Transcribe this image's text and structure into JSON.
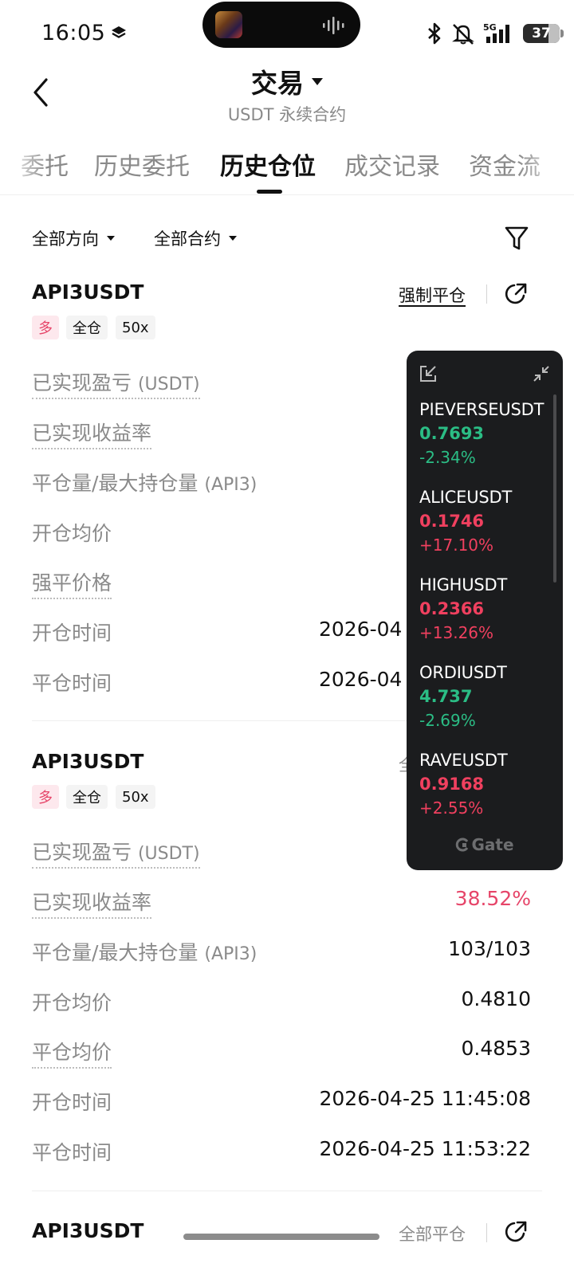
{
  "status_bar": {
    "time": "16:05",
    "network": "5G",
    "battery": "37"
  },
  "header": {
    "title": "交易",
    "subtitle": "USDT 永续合约"
  },
  "tabs": [
    {
      "label": "委托"
    },
    {
      "label": "历史委托"
    },
    {
      "label": "历史仓位"
    },
    {
      "label": "成交记录"
    },
    {
      "label": "资金流"
    }
  ],
  "filters": {
    "direction": "全部方向",
    "contract": "全部合约"
  },
  "positions": [
    {
      "symbol": "API3USDT",
      "action": "强制平仓",
      "tags": {
        "side": "多",
        "margin": "全仓",
        "leverage": "50x"
      },
      "rows": [
        {
          "label": "已实现盈亏",
          "unit": "(USDT)",
          "value": ""
        },
        {
          "label": "已实现收益率",
          "value": ""
        },
        {
          "label": "平仓量/最大持仓量",
          "unit": "(API3)",
          "value": ""
        },
        {
          "label": "开仓均价",
          "value": ""
        },
        {
          "label": "强平价格",
          "value": ""
        },
        {
          "label": "开仓时间",
          "value": "2026-04"
        },
        {
          "label": "平仓时间",
          "value": "2026-04"
        }
      ]
    },
    {
      "symbol": "API3USDT",
      "action": "全",
      "tags": {
        "side": "多",
        "margin": "全仓",
        "leverage": "50x"
      },
      "rows": [
        {
          "label": "已实现盈亏",
          "unit": "(USDT)",
          "value": ""
        },
        {
          "label": "已实现收益率",
          "value": "38.52%"
        },
        {
          "label": "平仓量/最大持仓量",
          "unit": "(API3)",
          "value": "103/103"
        },
        {
          "label": "开仓均价",
          "value": "0.4810"
        },
        {
          "label": "平仓均价",
          "value": "0.4853"
        },
        {
          "label": "开仓时间",
          "value": "2026-04-25 11:45:08"
        },
        {
          "label": "平仓时间",
          "value": "2026-04-25 11:53:22"
        }
      ]
    },
    {
      "symbol": "API3USDT",
      "action": "全部平仓"
    }
  ],
  "ticker_widget": {
    "items": [
      {
        "symbol": "PIEVERSEUSDT",
        "price": "0.7693",
        "change": "-2.34%",
        "trend": "down"
      },
      {
        "symbol": "ALICEUSDT",
        "price": "0.1746",
        "change": "+17.10%",
        "trend": "up"
      },
      {
        "symbol": "HIGHUSDT",
        "price": "0.2366",
        "change": "+13.26%",
        "trend": "up"
      },
      {
        "symbol": "ORDIUSDT",
        "price": "4.737",
        "change": "-2.69%",
        "trend": "down"
      },
      {
        "symbol": "RAVEUSDT",
        "price": "0.9168",
        "change": "+2.55%",
        "trend": "up"
      }
    ],
    "brand": "Gate",
    "colors": {
      "up": "#f0405f",
      "down": "#2bbd85"
    }
  },
  "colors": {
    "accent_red": "#e64569",
    "text_muted": "#8a8a8a"
  }
}
